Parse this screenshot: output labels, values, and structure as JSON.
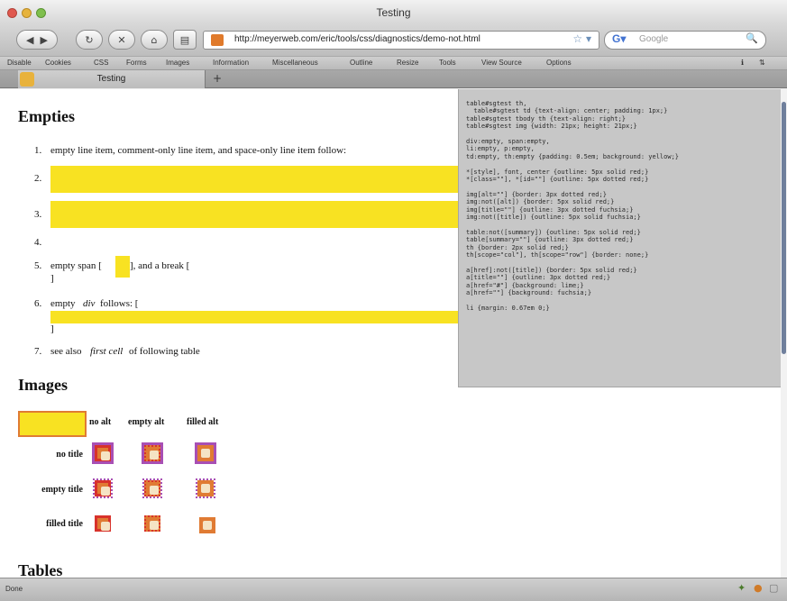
{
  "window": {
    "title": "Testing"
  },
  "toolbar": {
    "url": "http://meyerweb.com/eric/tools/css/diagnostics/demo-not.html",
    "search_placeholder": "Google"
  },
  "devbar": {
    "items": [
      "Disable",
      "Cookies",
      "CSS",
      "Forms",
      "Images",
      "Information",
      "Miscellaneous",
      "Outline",
      "Resize",
      "Tools",
      "View Source",
      "Options"
    ]
  },
  "tabs": [
    {
      "label": "Testing"
    }
  ],
  "page": {
    "empties_heading": "Empties",
    "list": [
      {
        "num": "1.",
        "text": "empty line item, comment-only line item, and space-only line item follow:"
      },
      {
        "num": "2.",
        "text": ""
      },
      {
        "num": "3.",
        "text": ""
      },
      {
        "num": "4.",
        "text": ""
      },
      {
        "num": "5.",
        "text_a": "empty span [",
        "text_b": "], and a break [",
        "text_c": "]"
      },
      {
        "num": "6.",
        "text_a": "empty",
        "text_em": "div",
        "text_b": "follows: [",
        "text_c": "]"
      },
      {
        "num": "7.",
        "text_a": "see also",
        "text_em": "first cell",
        "text_b": "of following table"
      }
    ],
    "images_heading": "Images",
    "images_table": {
      "col_headers": [
        "no alt",
        "empty alt",
        "filled alt"
      ],
      "row_headers": [
        "no title",
        "empty title",
        "filled title"
      ]
    },
    "tables_heading": "Tables"
  },
  "css_panel": {
    "text": "table#sgtest th,\n  table#sgtest td {text-align: center; padding: 1px;}\ntable#sgtest tbody th {text-align: right;}\ntable#sgtest img {width: 21px; height: 21px;}\n\ndiv:empty, span:empty,\nli:empty, p:empty,\ntd:empty, th:empty {padding: 0.5em; background: yellow;}\n\n*[style], font, center {outline: 5px solid red;}\n*[class=\"\"], *[id=\"\"] {outline: 5px dotted red;}\n\nimg[alt=\"\"] {border: 3px dotted red;}\nimg:not([alt]) {border: 5px solid red;}\nimg[title=\"\"] {outline: 3px dotted fuchsia;}\nimg:not([title]) {outline: 5px solid fuchsia;}\n\ntable:not([summary]) {outline: 5px solid red;}\ntable[summary=\"\"] {outline: 3px dotted red;}\nth {border: 2px solid red;}\nth[scope=\"col\"], th[scope=\"row\"] {border: none;}\n\na[href]:not([title]) {border: 5px solid red;}\na[title=\"\"] {outline: 3px dotted red;}\na[href=\"#\"] {background: lime;}\na[href=\"\"] {background: fuchsia;}\n\nli {margin: 0.67em 0;}"
  },
  "status": {
    "text": "Done"
  },
  "colors": {
    "highlight": "#f8e222",
    "outline_red": "#d8322b",
    "outline_fuchsia": "#a84fb4"
  }
}
